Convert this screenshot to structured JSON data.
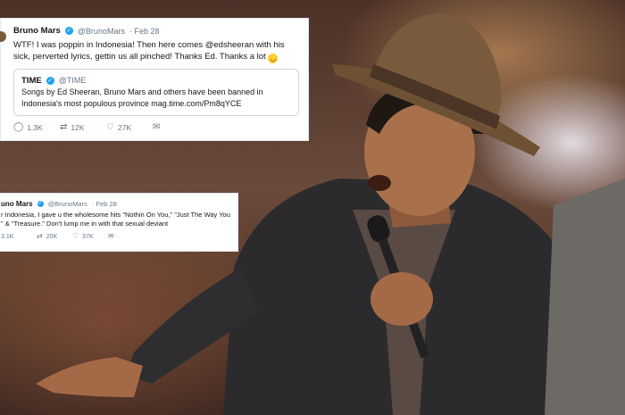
{
  "tweet_main": {
    "author": "Bruno Mars",
    "handle": "@BrunoMars",
    "date": "· Feb 28",
    "text": "WTF! I was poppin in Indonesia! Then here comes @edsheeran with his sick, perverted lyrics, gettin us all pinched! Thanks Ed. Thanks a lot",
    "emoji_icon": "smiley-face-icon",
    "quote": {
      "author": "TIME",
      "handle": "@TIME",
      "text": "Songs by Ed Sheeran, Bruno Mars and others have been banned in Indonesia's most populous province mag.time.com/Pm8qYCE"
    },
    "replies": "1.3K",
    "retweets": "12K",
    "likes": "27K"
  },
  "tweet_second": {
    "author": "uno Mars",
    "handle": "@BrunoMars",
    "date": "· Feb 28",
    "text": "r Indonesia, I gave u the wholesome hits \"Nothin On You,\" \"Just The Way You\n\" & \"Treasure.\" Don't lump me in with that sexual deviant",
    "replies": "3.1K",
    "retweets": "20K",
    "likes": "37K"
  },
  "colors": {
    "verified": "#1da1f2",
    "card_bg": "#ffffff",
    "muted_text": "#657786"
  }
}
